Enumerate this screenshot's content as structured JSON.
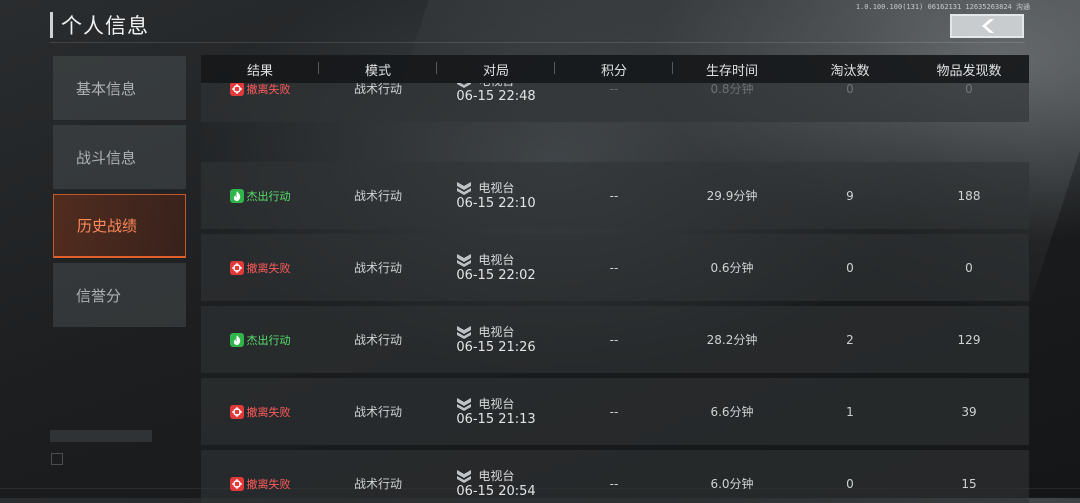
{
  "header": {
    "title": "个人信息",
    "build_info": "1.0.100.100(131) 06162131 12635263824 沟通"
  },
  "sidebar": {
    "items": [
      {
        "label": "基本信息",
        "active": false
      },
      {
        "label": "战斗信息",
        "active": false
      },
      {
        "label": "历史战绩",
        "active": true
      },
      {
        "label": "信誉分",
        "active": false
      }
    ]
  },
  "colors": {
    "fail": "#ff5a5a",
    "success": "#57e06b",
    "active_tab": "#ff8a5a"
  },
  "table": {
    "headers": [
      "结果",
      "模式",
      "对局",
      "积分",
      "生存时间",
      "淘汰数",
      "物品发现数"
    ],
    "rows": [
      {
        "result": "撤离失败",
        "result_type": "fail",
        "mode": "战术行动",
        "map": "电视台",
        "date": "06-15 22:48",
        "score": "--",
        "survival": "0.8分钟",
        "kills": "0",
        "items": "0"
      },
      {
        "result": "杰出行动",
        "result_type": "success",
        "mode": "战术行动",
        "map": "电视台",
        "date": "06-15 22:10",
        "score": "--",
        "survival": "29.9分钟",
        "kills": "9",
        "items": "188"
      },
      {
        "result": "撤离失败",
        "result_type": "fail",
        "mode": "战术行动",
        "map": "电视台",
        "date": "06-15 22:02",
        "score": "--",
        "survival": "0.6分钟",
        "kills": "0",
        "items": "0"
      },
      {
        "result": "杰出行动",
        "result_type": "success",
        "mode": "战术行动",
        "map": "电视台",
        "date": "06-15 21:26",
        "score": "--",
        "survival": "28.2分钟",
        "kills": "2",
        "items": "129"
      },
      {
        "result": "撤离失败",
        "result_type": "fail",
        "mode": "战术行动",
        "map": "电视台",
        "date": "06-15 21:13",
        "score": "--",
        "survival": "6.6分钟",
        "kills": "1",
        "items": "39"
      },
      {
        "result": "撤离失败",
        "result_type": "fail",
        "mode": "战术行动",
        "map": "电视台",
        "date": "06-15 20:54",
        "score": "--",
        "survival": "6.0分钟",
        "kills": "0",
        "items": "15"
      }
    ]
  },
  "icons": {
    "back": "chevron-left-icon",
    "fail": "crosshair-icon",
    "success": "flame-icon",
    "map": "rank-chevron-icon"
  }
}
